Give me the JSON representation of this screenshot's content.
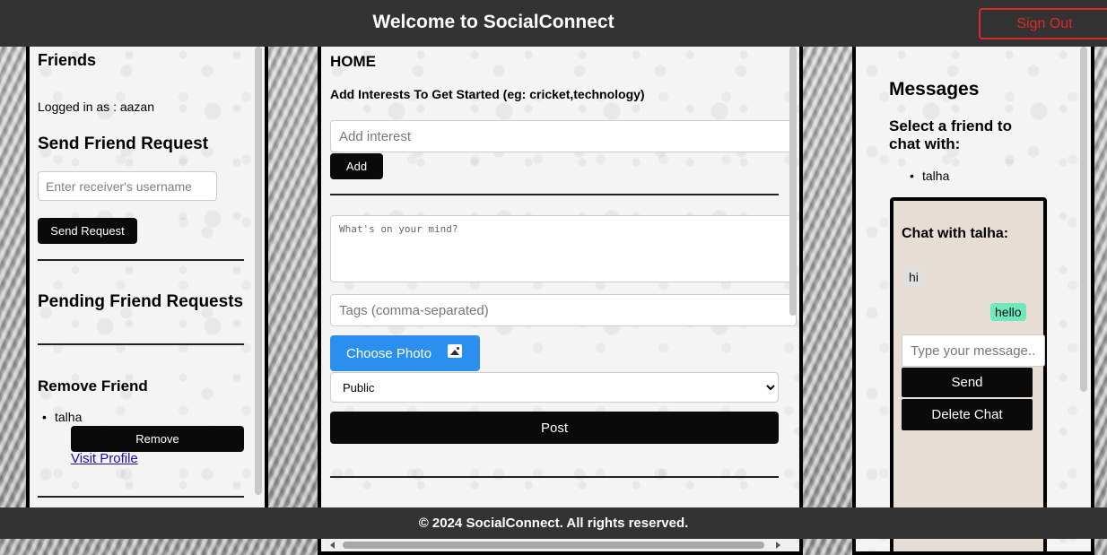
{
  "header": {
    "title": "Welcome to SocialConnect",
    "sign_out_label": "Sign Out"
  },
  "left_panel": {
    "title": "Friends",
    "logged_in": "Logged in as : aazan",
    "send_request_title": "Send Friend Request",
    "receiver_placeholder": "Enter receiver's username",
    "send_request_label": "Send Request",
    "pending_title": "Pending Friend Requests",
    "remove_title": "Remove Friend",
    "friends": [
      {
        "name": "talha",
        "remove_label": "Remove",
        "visit_label": "Visit Profile"
      }
    ]
  },
  "center_panel": {
    "title": "HOME",
    "interests_prompt": "Add Interests To Get Started (eg: cricket,technology)",
    "interest_placeholder": "Add interest",
    "add_label": "Add",
    "post_placeholder": "What's on your mind?",
    "tags_placeholder": "Tags (comma-separated)",
    "choose_photo_label": "Choose Photo",
    "visibility_selected": "Public",
    "post_label": "Post"
  },
  "right_panel": {
    "title": "Messages",
    "select_prompt": "Select a friend to chat with:",
    "friends": [
      "talha"
    ],
    "chat": {
      "title": "Chat with talha:",
      "messages": [
        {
          "text": "hi",
          "direction": "incoming"
        },
        {
          "text": "hello",
          "direction": "outgoing"
        }
      ],
      "input_placeholder": "Type your message...",
      "send_label": "Send",
      "delete_label": "Delete Chat"
    }
  },
  "footer": {
    "text": "© 2024 SocialConnect. All rights reserved."
  },
  "colors": {
    "header_bg": "#333333",
    "sign_out": "#e0272c",
    "photo_button": "#2b8ff0",
    "outgoing_bubble": "#6fe8bb",
    "chat_bg": "#e6ddd5"
  }
}
